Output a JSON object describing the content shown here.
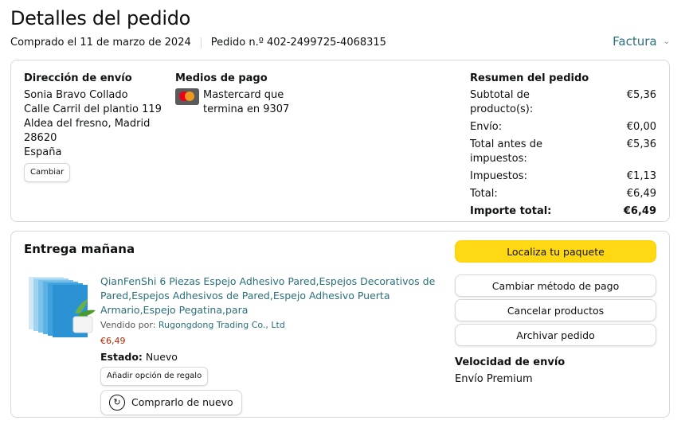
{
  "header": {
    "title": "Detalles del pedido",
    "ordered": "Comprado el 11 de marzo de 2024",
    "order_number": "Pedido n.º 402-2499725-4068315",
    "invoice": "Factura"
  },
  "shipping": {
    "heading": "Dirección de envío",
    "lines": [
      "Sonia Bravo Collado",
      "Calle Carril del plantio 119",
      "Aldea del fresno, Madrid",
      "28620",
      "España"
    ],
    "change_label": "Cambiar"
  },
  "payment": {
    "heading": "Medios de pago",
    "text": "Mastercard que termina en 9307",
    "logo_text": "MasterCard"
  },
  "summary": {
    "heading": "Resumen del pedido",
    "rows": [
      {
        "label": "Subtotal de producto(s):",
        "value": "€5,36"
      },
      {
        "label": "Envío:",
        "value": "€0,00"
      },
      {
        "label": "Total antes de impuestos:",
        "value": "€5,36"
      },
      {
        "label": "Impuestos:",
        "value": "€1,13"
      },
      {
        "label": "Total:",
        "value": "€6,49"
      }
    ],
    "grand_total": {
      "label": "Importe total:",
      "value": "€6,49"
    }
  },
  "delivery": {
    "heading": "Entrega mañana",
    "product": {
      "title": "QianFenShi 6 Piezas Espejo Adhesivo Pared,Espejos Decorativos de Pared,Espejos Adhesivos de Pared,Espejo Adhesivo Puerta Armario,Espejo Pegatina,para",
      "seller_prefix": "Vendido por: ",
      "seller": "Rugongdong Trading Co., Ltd",
      "price": "€6,49",
      "condition_label": "Estado:",
      "condition_value": "Nuevo",
      "gift_label": "Añadir opción de regalo",
      "rebuy_label": "Comprarlo de nuevo"
    },
    "actions": {
      "track": "Localiza tu paquete",
      "change_payment": "Cambiar método de pago",
      "cancel": "Cancelar productos",
      "archive": "Archivar pedido"
    },
    "speed": {
      "heading": "Velocidad de envío",
      "value": "Envío Premium"
    }
  },
  "colors": {
    "link": "#2a6f79",
    "price": "#b12704",
    "primary_button": "#ffd814"
  }
}
